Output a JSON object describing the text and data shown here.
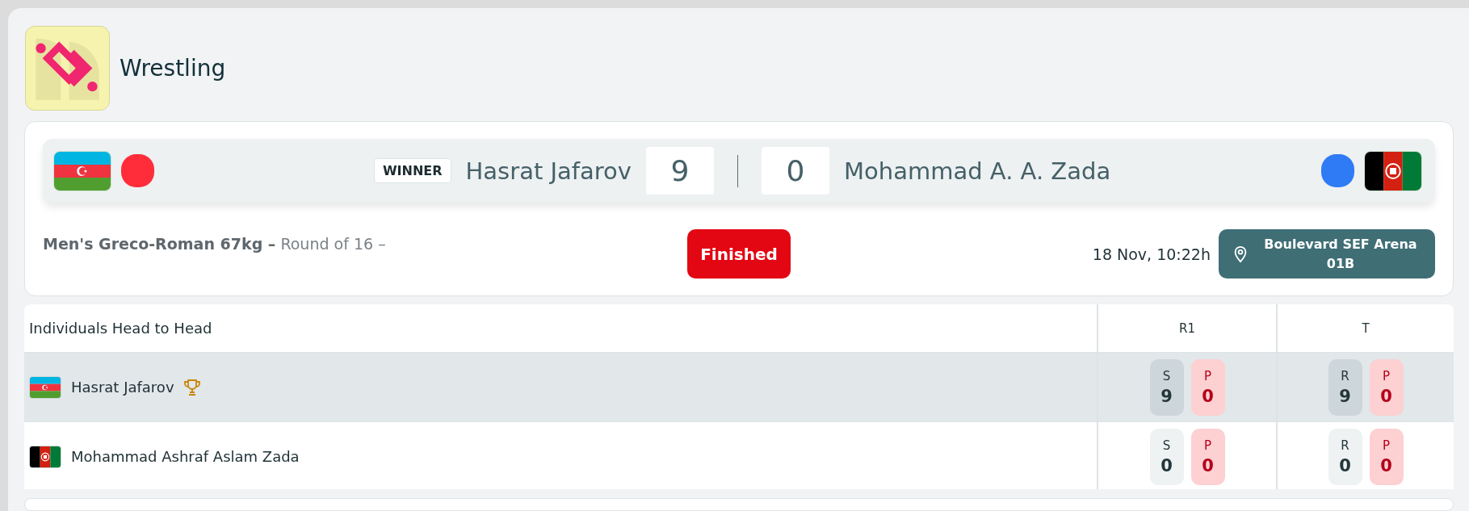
{
  "sport": {
    "title": "Wrestling"
  },
  "match": {
    "winner_label": "WINNER",
    "athletes": [
      {
        "name": "Hasrat Jafarov",
        "score": "9",
        "winner": true,
        "kind": "azerbaijan",
        "color": "#ff2d3a"
      },
      {
        "name": "Mohammad A. A. Zada",
        "score": "0",
        "winner": false,
        "kind": "afghanistan",
        "color": "#2f7bf5"
      }
    ]
  },
  "event": {
    "category": "Men's Greco-Roman 67kg –",
    "round": "Round of 16 –",
    "status": "Finished",
    "datetime": "18 Nov, 10:22h",
    "venue": "Boulevard SEF Arena 01B"
  },
  "head_to_head": {
    "title": "Individuals Head to Head",
    "columns": [
      "R1",
      "T"
    ],
    "rows": [
      {
        "name": "Hasrat Jafarov",
        "kind": "azerbaijan",
        "winner": true,
        "cells": [
          [
            {
              "kind": "score",
              "label": "S",
              "value": "9"
            },
            {
              "kind": "penalty",
              "label": "P",
              "value": "0"
            }
          ],
          [
            {
              "kind": "score",
              "label": "R",
              "value": "9"
            },
            {
              "kind": "penalty",
              "label": "P",
              "value": "0"
            }
          ]
        ]
      },
      {
        "name": "Mohammad Ashraf Aslam Zada",
        "kind": "afghanistan",
        "winner": false,
        "cells": [
          [
            {
              "kind": "score",
              "label": "S",
              "value": "0"
            },
            {
              "kind": "penalty",
              "label": "P",
              "value": "0"
            }
          ],
          [
            {
              "kind": "score",
              "label": "R",
              "value": "0"
            },
            {
              "kind": "penalty",
              "label": "P",
              "value": "0"
            }
          ]
        ]
      }
    ]
  }
}
